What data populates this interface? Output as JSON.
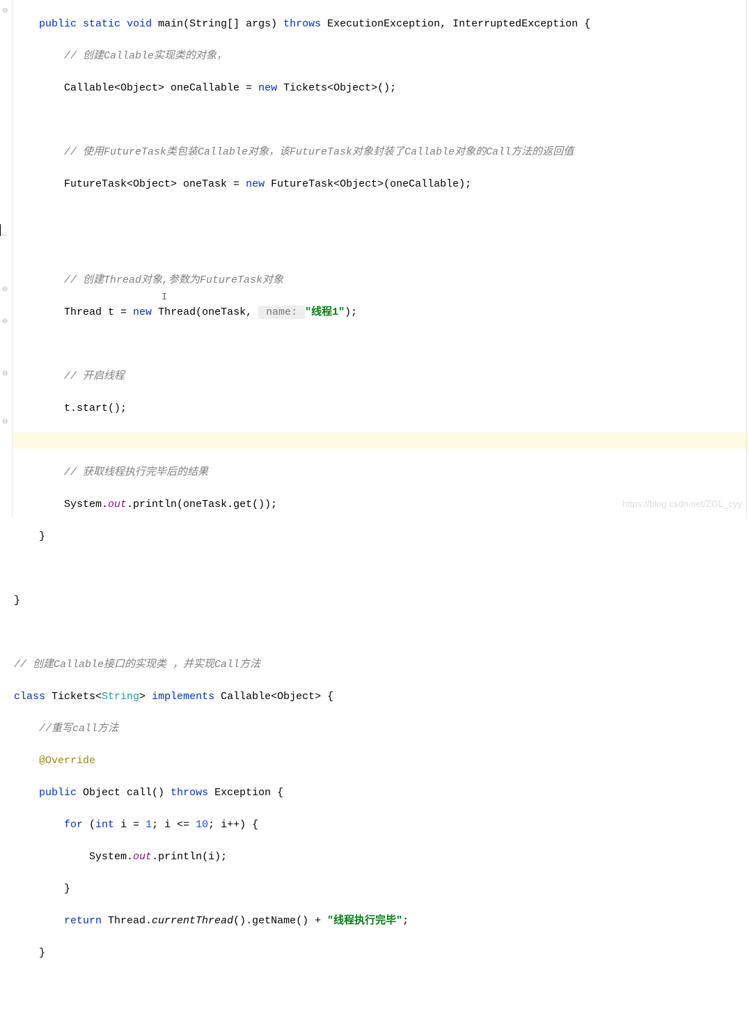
{
  "lines": {
    "l1_public": "public",
    "l1_static": "static",
    "l1_void": "void",
    "l1_main": " main(String[] args) ",
    "l1_throws": "throws",
    "l1_ex": " ExecutionException, InterruptedException {",
    "l2_comment": "// 创建Callable实现类的对象，",
    "l3_a": "Callable<Object> oneCallable = ",
    "l3_new": "new",
    "l3_b": " Tickets<Object>();",
    "l5_comment": "// 使用FutureTask类包装Callable对象，该FutureTask对象封装了Callable对象的Call方法的返回值",
    "l6_a": "FutureTask<Object> oneTask = ",
    "l6_new": "new",
    "l6_b": " FutureTask<Object>(oneCallable);",
    "l9_comment": "// 创建Thread对象,参数为FutureTask对象",
    "l10_a": "Thread t = ",
    "l10_new": "new",
    "l10_b": " Thread(oneTask, ",
    "l10_hint": " name: ",
    "l10_str": "\"线程1\"",
    "l10_c": ");",
    "l12_comment": "// 开启线程",
    "l13": "t.start();",
    "l15_comment": "// 获取线程执行完毕后的结果",
    "l16_a": "System.",
    "l16_out": "out",
    "l16_b": ".println(oneTask.get());",
    "l17": "}",
    "l19": "}",
    "l21_comment": "// 创建Callable接口的实现类 ，并实现Call方法",
    "l22_class": "class",
    "l22_a": " Tickets<",
    "l22_generic": "String",
    "l22_b": "> ",
    "l22_impl": "implements",
    "l22_c": " Callable<Object> {",
    "l23_comment": "//重写call方法",
    "l24_anno": "@Override",
    "l25_public": "public",
    "l25_a": " Object call() ",
    "l25_throws": "throws",
    "l25_b": " Exception {",
    "l26_for": "for",
    "l26_a": " (",
    "l26_int": "int",
    "l26_b": " i = ",
    "l26_n1": "1",
    "l26_c": "; i <= ",
    "l26_n10": "10",
    "l26_d": "; i++) {",
    "l27_a": "System.",
    "l27_out": "out",
    "l27_b": ".println(i);",
    "l28": "}",
    "l29_return": "return",
    "l29_a": " Thread.",
    "l29_ct": "currentThread",
    "l29_b": "().getName() + ",
    "l29_str": "\"线程执行完毕\"",
    "l29_c": ";",
    "l30": "}"
  },
  "watermark": "https://blog.csdn.net/ZGL_cyy"
}
